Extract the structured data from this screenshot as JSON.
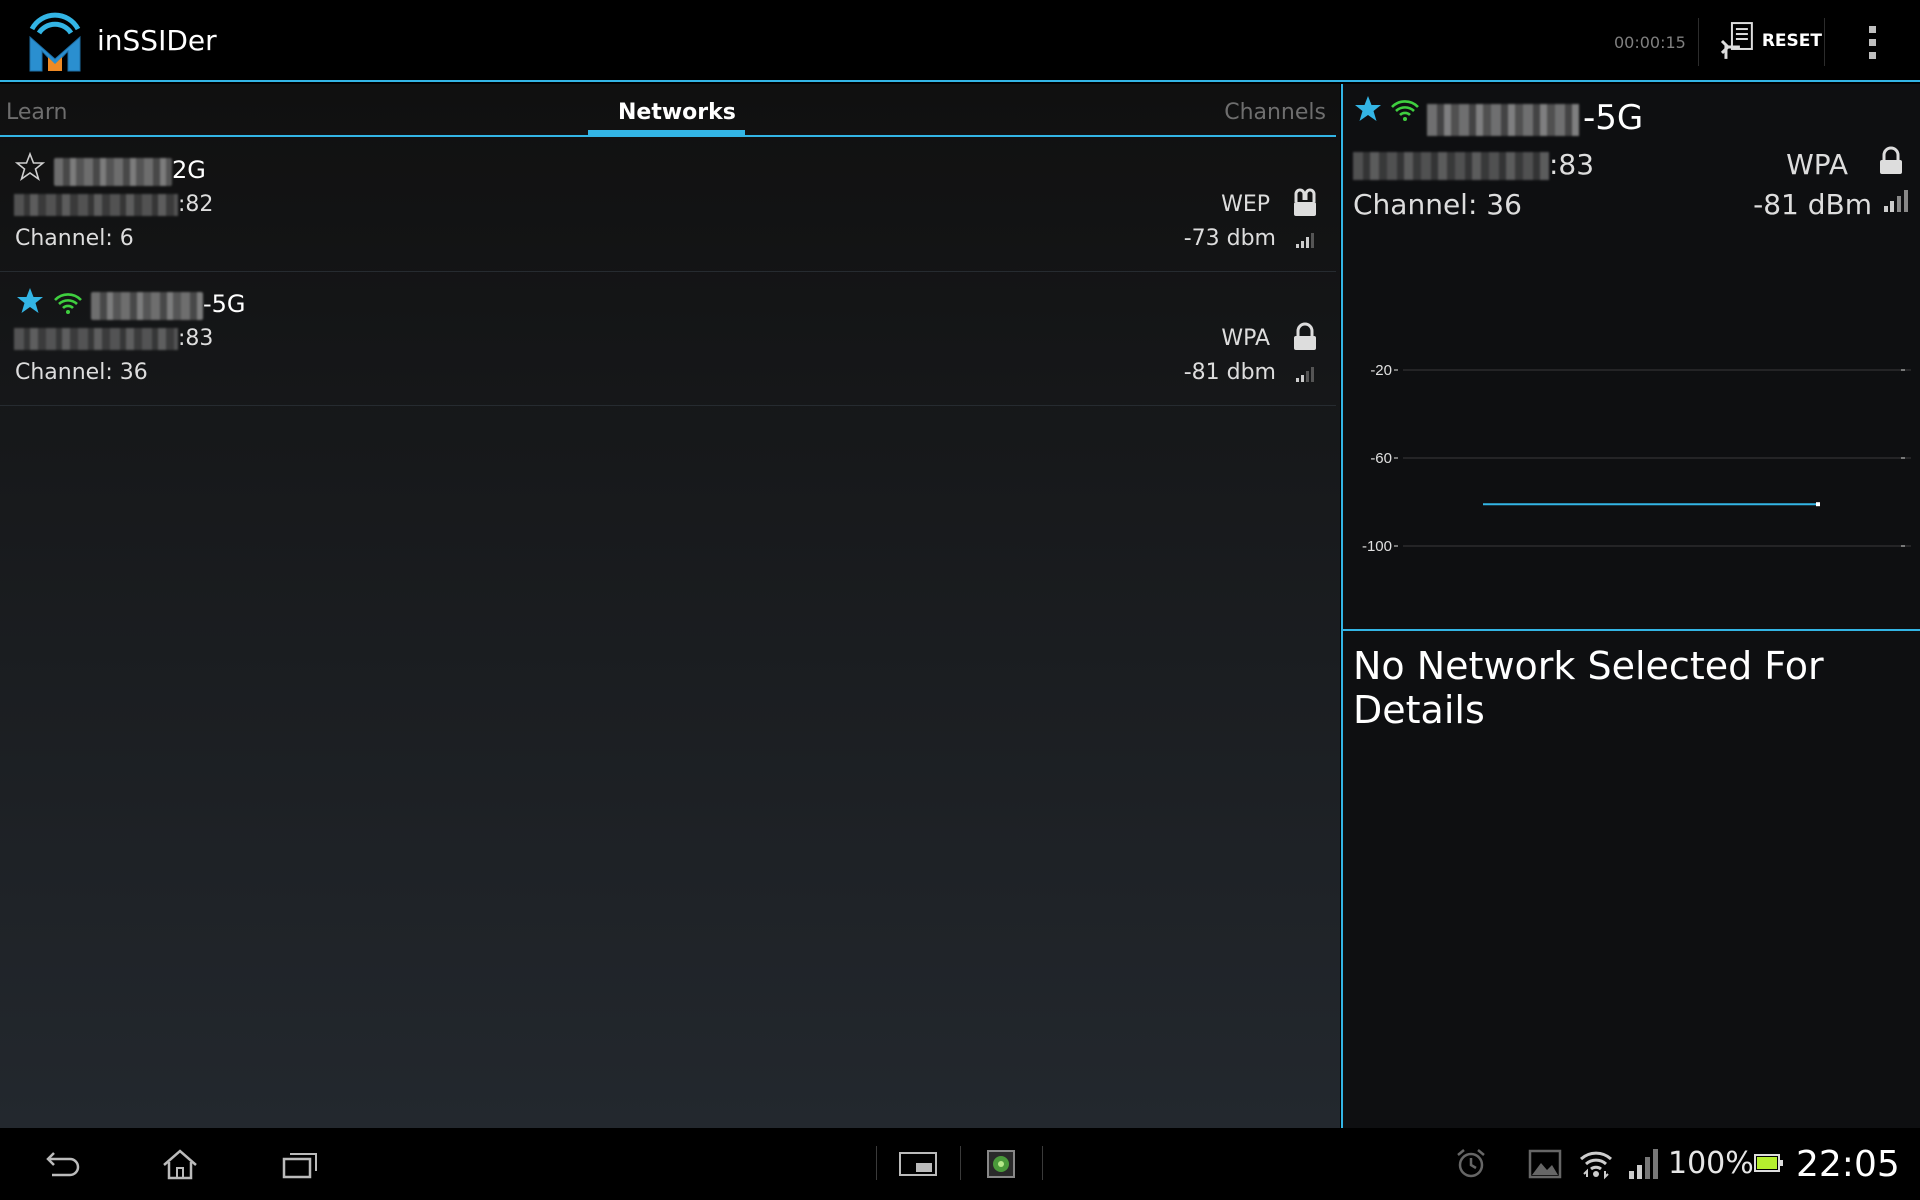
{
  "action_bar": {
    "app_title": "inSSIDer",
    "elapsed_time": "00:00:15",
    "reset_label": "RESET"
  },
  "tabs": [
    {
      "label": "Learn",
      "selected": false
    },
    {
      "label": "Networks",
      "selected": true
    },
    {
      "label": "Channels",
      "selected": false
    }
  ],
  "networks": [
    {
      "ssid_suffix": "2G",
      "favorite": false,
      "connected": false,
      "mac_suffix": ":82",
      "security": "WEP",
      "security_icon": "unlocked-lock-icon",
      "channel": "Channel: 6",
      "signal": "-73 dbm"
    },
    {
      "ssid_suffix": "-5G",
      "favorite": true,
      "connected": true,
      "mac_suffix": ":83",
      "security": "WPA",
      "security_icon": "lock-icon",
      "channel": "Channel: 36",
      "signal": "-81 dbm"
    }
  ],
  "detail": {
    "ssid_suffix": "-5G",
    "mac_suffix": ":83",
    "security": "WPA",
    "channel": "Channel: 36",
    "signal": "-81 dBm",
    "no_selection_text": "No Network Selected For Details"
  },
  "chart_data": {
    "type": "line",
    "title": "",
    "xlabel": "",
    "ylabel": "",
    "y_ticks": [
      "-20",
      "-60",
      "-100"
    ],
    "ylim": [
      -100,
      -20
    ],
    "grid": true,
    "series": [
      {
        "color": "#33b5e5",
        "values": [
          -81,
          -81
        ]
      }
    ]
  },
  "status_bar": {
    "battery_percent": "100%",
    "time": "22:05"
  },
  "colors": {
    "accent": "#33b5e5",
    "favorite_star": "#33b5e5",
    "connected_wifi": "#3fcf3f",
    "battery": "#b5ef2e"
  }
}
